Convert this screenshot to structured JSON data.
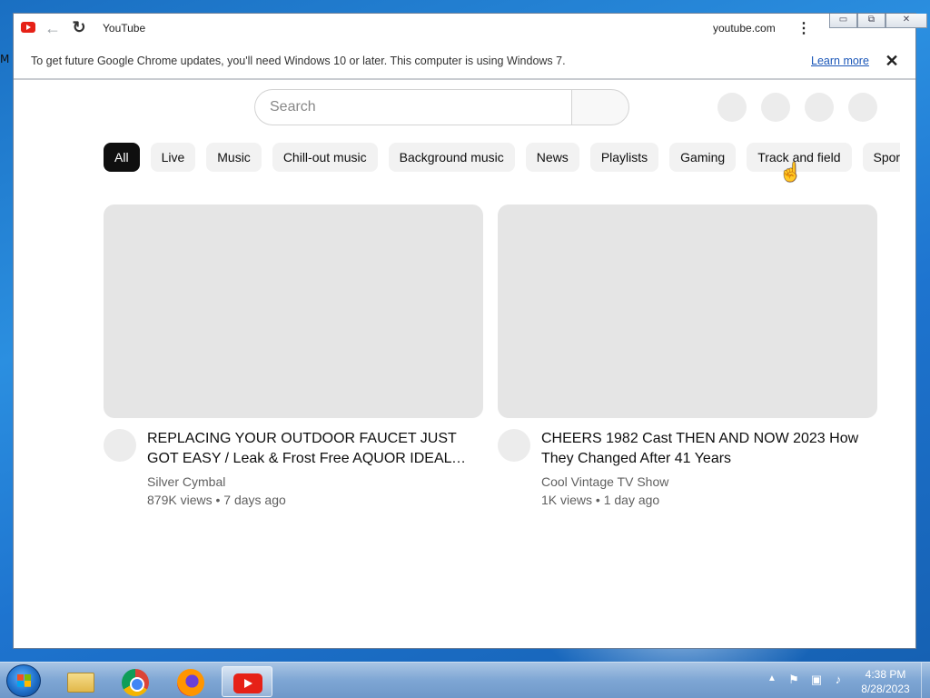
{
  "desktop": {
    "label_fragment": "M"
  },
  "browser": {
    "tab_title": "YouTube",
    "domain": "youtube.com",
    "icons": {
      "back": "back-arrow-icon",
      "reload": "reload-icon",
      "menu": "kebab-menu-icon"
    },
    "window_controls": {
      "minimize": "▭",
      "restore": "⧉",
      "close": "✕"
    }
  },
  "infobar": {
    "message": "To get future Google Chrome updates, you'll need Windows 10 or later. This computer is using Windows 7.",
    "link": "Learn more",
    "close": "✕"
  },
  "youtube": {
    "search_placeholder": "Search",
    "chips": [
      {
        "label": "All",
        "active": true
      },
      {
        "label": "Live"
      },
      {
        "label": "Music"
      },
      {
        "label": "Chill-out music"
      },
      {
        "label": "Background music"
      },
      {
        "label": "News"
      },
      {
        "label": "Playlists"
      },
      {
        "label": "Gaming"
      },
      {
        "label": "Track and field"
      },
      {
        "label": "Sports"
      }
    ],
    "videos": [
      {
        "title": "REPLACING YOUR OUTDOOR FAUCET JUST GOT EASY / Leak & Frost Free AQUOR IDEAL HOSE BIB",
        "channel": "Silver Cymbal",
        "meta": "879K views • 7 days ago"
      },
      {
        "title": "CHEERS 1982 Cast THEN AND NOW 2023 How They Changed After 41 Years",
        "channel": "Cool Vintage TV Show",
        "meta": "1K views • 1 day ago"
      }
    ]
  },
  "taskbar": {
    "apps": [
      "windows-explorer",
      "google-chrome",
      "firefox",
      "youtube"
    ],
    "time": "4:38 PM",
    "date": "8/28/2023"
  }
}
